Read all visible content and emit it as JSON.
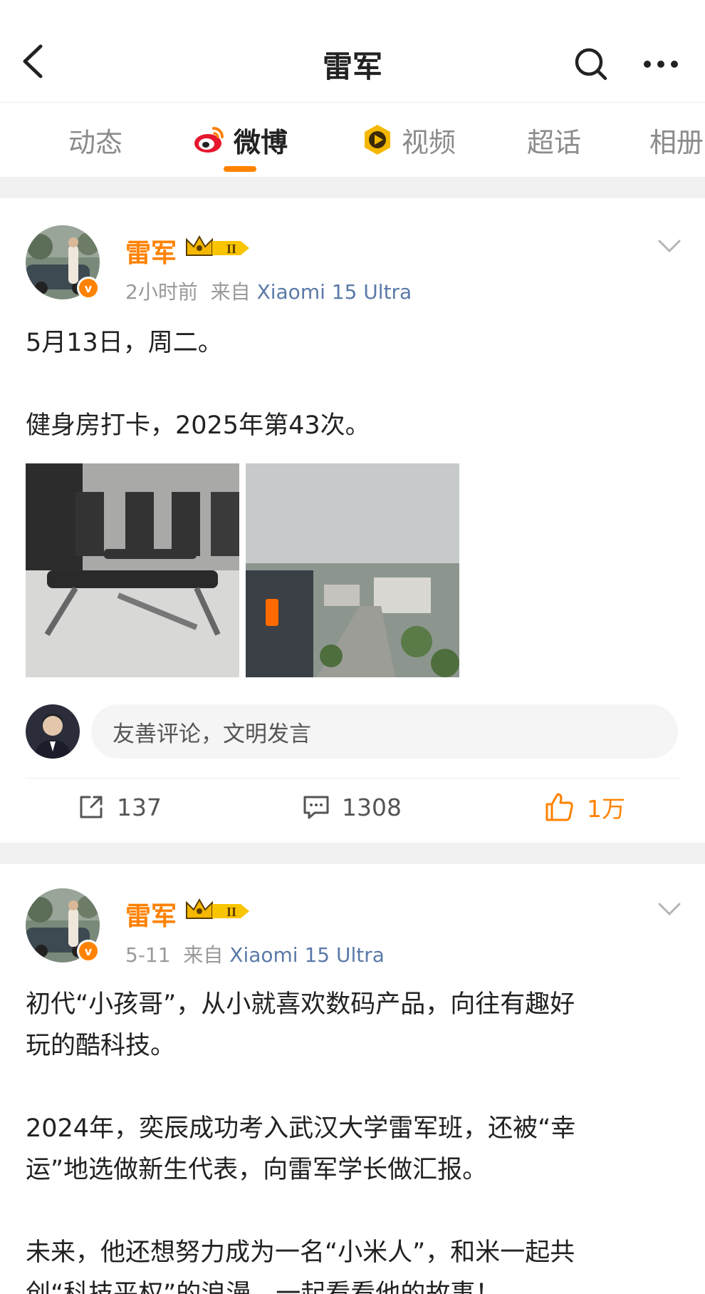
{
  "nav": {
    "title": "雷军",
    "back_icon": "chevron-left-icon",
    "search_icon": "search-icon",
    "more_icon": "more-icon"
  },
  "tabs": [
    {
      "label": "动态",
      "icon": null,
      "active": false
    },
    {
      "label": "微博",
      "icon": "weibo-icon",
      "active": true
    },
    {
      "label": "视频",
      "icon": "video-play-icon",
      "active": false
    },
    {
      "label": "超话",
      "icon": null,
      "active": false
    },
    {
      "label": "相册",
      "icon": null,
      "active": false
    }
  ],
  "colors": {
    "accent": "#ff8200",
    "link": "#5a7aa8",
    "muted": "#9a9a9a",
    "separator": "#f1f1f1"
  },
  "posts": [
    {
      "author": "雷军",
      "level_badge": "II",
      "time": "2小时前",
      "source_prefix": "来自",
      "source": "Xiaomi 15 Ultra",
      "lines": [
        "5月13日，周二。",
        "健身房打卡，2025年第43次。"
      ],
      "images": [
        "gym-equipment-photo",
        "xiaomi-building-city-photo"
      ],
      "comment_placeholder": "友善评论，文明发言",
      "stats": {
        "reposts": "137",
        "comments": "1308",
        "likes": "1万"
      }
    },
    {
      "author": "雷军",
      "level_badge": "II",
      "time": "5-11",
      "source_prefix": "来自",
      "source": "Xiaomi 15 Ultra",
      "lines": [
        "初代“小孩哥”，从小就喜欢数码产品，向往有趣好",
        "玩的酷科技。",
        "2024年，奕辰成功考入武汉大学雷军班，还被“幸",
        "运”地选做新生代表，向雷军学长做汇报。",
        "未来，他还想努力成为一名“小米人”，和米一起共",
        "创“科技平权”的浪漫，一起看看他的故事！"
      ]
    }
  ]
}
